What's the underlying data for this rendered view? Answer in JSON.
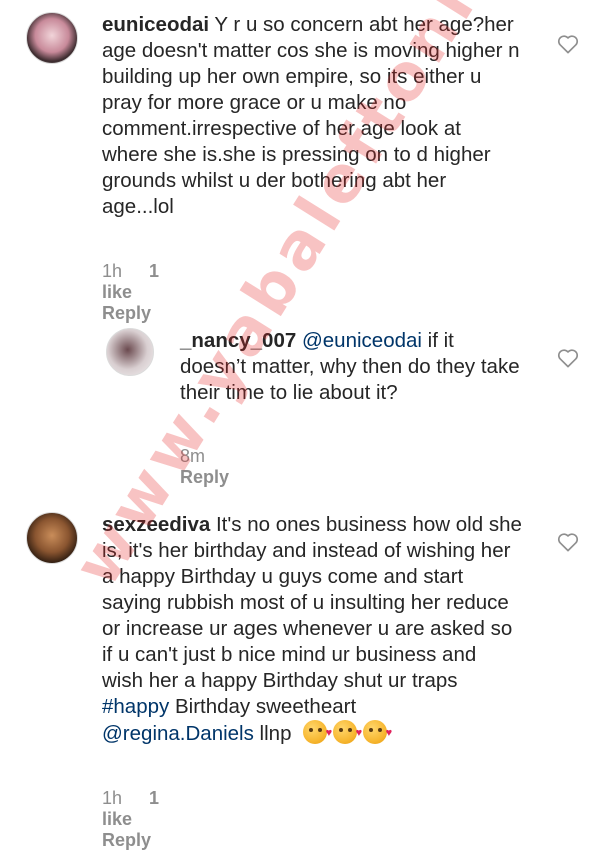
{
  "comments": [
    {
      "username": "euniceodai",
      "body": "Y r u so concern abt her age?her age doesn't matter cos she is moving higher n building up her own empire, so its either u pray for more grace or u  make no comment.irrespective of her age look at where she is.she is pressing on to d higher grounds whilst u der bothering abt her age...lol",
      "time": "1h",
      "likes": "1 like",
      "reply_label": "Reply"
    },
    {
      "username": "_nancy_007",
      "mention": "@euniceodai",
      "body": " if it doesn’t matter, why then do they take their time to lie about it?",
      "time": "8m",
      "reply_label": "Reply"
    },
    {
      "username": "sexzeediva",
      "body": " It's no ones business how old she is, it's  her birthday and instead of wishing her a happy Birthday u guys come and start saying rubbish most of u insulting her reduce or increase ur ages whenever u are asked so if u can't just b nice mind ur business and wish her a happy Birthday shut ur traps ",
      "hashtag": "#happy",
      "body_after_hashtag": " Birthday sweetheart",
      "mention": "@regina.Daniels",
      "tail": "  llnp",
      "time": "1h",
      "likes": "1 like",
      "reply_label": "Reply"
    }
  ],
  "icons": {
    "heart": "heart-outline-icon",
    "emoji": "face-blowing-kiss-emoji"
  },
  "watermark": "www.yabaleftonline.com",
  "colors": {
    "text": "#262626",
    "meta": "#8e8e8e",
    "link": "#003569",
    "watermark": "#e62828"
  }
}
